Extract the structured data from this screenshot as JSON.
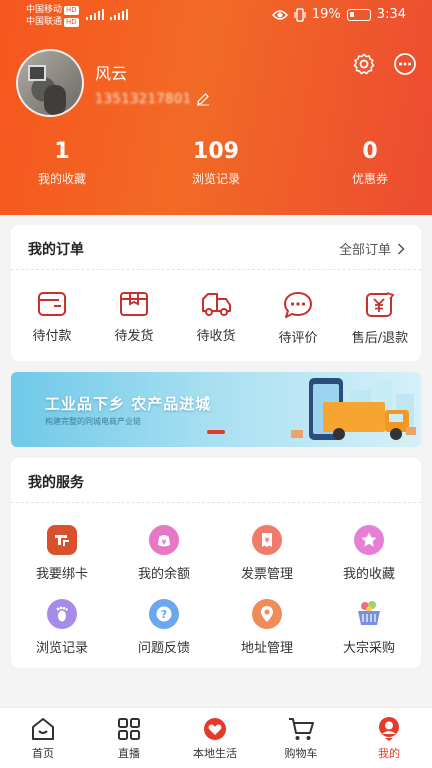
{
  "status_bar": {
    "carrier1": "中国移动",
    "carrier2": "中国联通",
    "hd": "HD",
    "battery": "19%",
    "time": "3:34"
  },
  "profile": {
    "username": "风云",
    "phone": "13513217801"
  },
  "stats": [
    {
      "value": "1",
      "label": "我的收藏"
    },
    {
      "value": "109",
      "label": "浏览记录"
    },
    {
      "value": "0",
      "label": "优惠券"
    }
  ],
  "orders": {
    "title": "我的订单",
    "all_link": "全部订单",
    "items": [
      {
        "label": "待付款",
        "icon": "wallet-icon"
      },
      {
        "label": "待发货",
        "icon": "box-icon"
      },
      {
        "label": "待收货",
        "icon": "truck-icon"
      },
      {
        "label": "待评价",
        "icon": "comment-icon"
      },
      {
        "label": "售后/退款",
        "icon": "refund-icon"
      }
    ]
  },
  "banner": {
    "title": "工业品下乡  农产品进城",
    "subtitle": "构建完整的同城电商产业链"
  },
  "services": {
    "title": "我的服务",
    "items": [
      {
        "label": "我要绑卡",
        "icon": "bind-card-icon",
        "color": "#d9512c"
      },
      {
        "label": "我的余额",
        "icon": "balance-icon",
        "color": "#e877c6"
      },
      {
        "label": "发票管理",
        "icon": "invoice-icon",
        "color": "#f07b6a"
      },
      {
        "label": "我的收藏",
        "icon": "star-icon",
        "color": "#e87fd6"
      },
      {
        "label": "浏览记录",
        "icon": "footprint-icon",
        "color": "#a58ce8"
      },
      {
        "label": "问题反馈",
        "icon": "question-icon",
        "color": "#6aa7ef"
      },
      {
        "label": "地址管理",
        "icon": "location-icon",
        "color": "#f08c58"
      },
      {
        "label": "大宗采购",
        "icon": "basket-icon",
        "color": "#7a8fe4"
      }
    ]
  },
  "nav": [
    {
      "label": "首页",
      "icon": "home-icon"
    },
    {
      "label": "直播",
      "icon": "grid-icon"
    },
    {
      "label": "本地生活",
      "icon": "heart-icon"
    },
    {
      "label": "购物车",
      "icon": "cart-icon"
    },
    {
      "label": "我的",
      "icon": "profile-icon",
      "active": true
    }
  ],
  "colors": {
    "brand": "#f25a22",
    "accent": "#e4392b"
  }
}
